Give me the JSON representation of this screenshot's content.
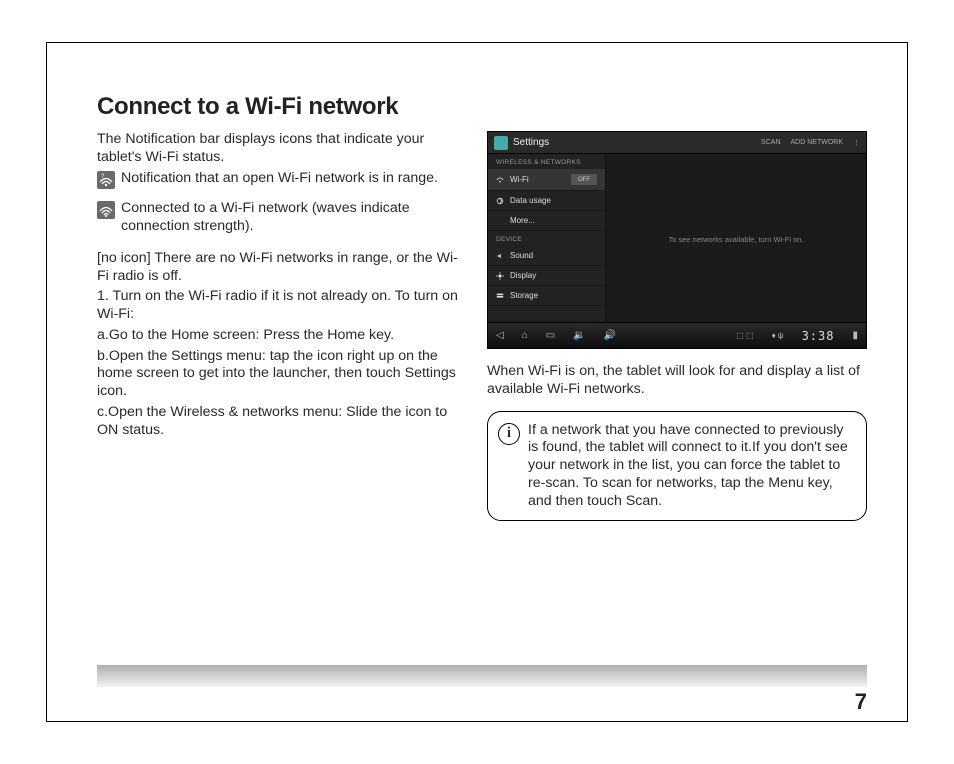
{
  "title": "Connect to a Wi-Fi network",
  "left": {
    "intro": "The Notification bar displays icons that indicate your tablet's Wi-Fi status.",
    "notif1": "Notification that an open Wi-Fi network is in range.",
    "notif2": "Connected to a Wi-Fi network (waves indicate connection strength).",
    "noicon": "[no icon] There are no Wi-Fi networks in range, or the Wi-Fi radio is off.",
    "step1": "1. Turn on the Wi-Fi radio if it is not already on. To turn on Wi-Fi:",
    "stepA": "a.Go to the Home screen: Press the Home key.",
    "stepB": "b.Open the Settings menu: tap the icon right up on the home screen to get into the launcher, then touch Settings icon.",
    "stepC": "c.Open the Wireless & networks menu: Slide the icon to ON status."
  },
  "screenshot": {
    "headerTitle": "Settings",
    "scan": "SCAN",
    "addNetwork": "ADD NETWORK",
    "sectionWireless": "WIRELESS & NETWORKS",
    "wifi": "Wi-Fi",
    "wifiToggle": "OFF",
    "dataUsage": "Data usage",
    "more": "More...",
    "sectionDevice": "DEVICE",
    "sound": "Sound",
    "display": "Display",
    "storage": "Storage",
    "mainMessage": "To see networks available, turn Wi-Fi on.",
    "clock": "3:38"
  },
  "right": {
    "text": "When Wi-Fi is on, the tablet will look for and display a list of available Wi-Fi networks.",
    "infoText": "If a network that you have connected to previously is found, the tablet will connect to it.If you don't see your network in the list, you can force the tablet to re-scan. To scan for networks, tap the Menu key, and then touch Scan."
  },
  "pageNumber": "7"
}
